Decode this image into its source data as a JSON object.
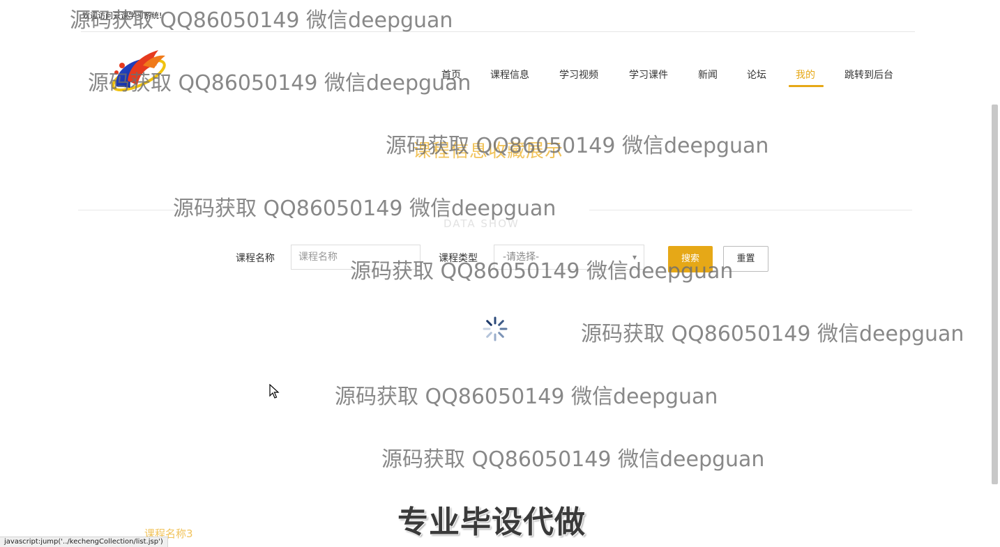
{
  "header": {
    "welcome": "欢迎访问云课学习系统!",
    "logo_icon": "flame-logo-icon"
  },
  "nav": {
    "items": [
      {
        "label": "首页"
      },
      {
        "label": "课程信息"
      },
      {
        "label": "学习视频"
      },
      {
        "label": "学习课件"
      },
      {
        "label": "新闻"
      },
      {
        "label": "论坛"
      },
      {
        "label": "我的"
      },
      {
        "label": "跳转到后台"
      }
    ],
    "active_label": "我的"
  },
  "section": {
    "title": "课程信息收藏展示",
    "subtitle": "DATA SHOW"
  },
  "search": {
    "course_name_label": "课程名称",
    "course_name_placeholder": "课程名称",
    "course_type_label": "课程类型",
    "course_type_selected": "-请选择-",
    "search_button": "搜索",
    "reset_button": "重置"
  },
  "list": {
    "first_item_name": "课程名称3"
  },
  "overlay": {
    "watermark": "源码获取 QQ86050149 微信deepguan",
    "promo": "专业毕设代做"
  },
  "status_bar": {
    "url": "javascript:jump('../kechengCollection/list.jsp')"
  },
  "colors": {
    "accent": "#e6a817",
    "title_light": "#f1c35b"
  }
}
